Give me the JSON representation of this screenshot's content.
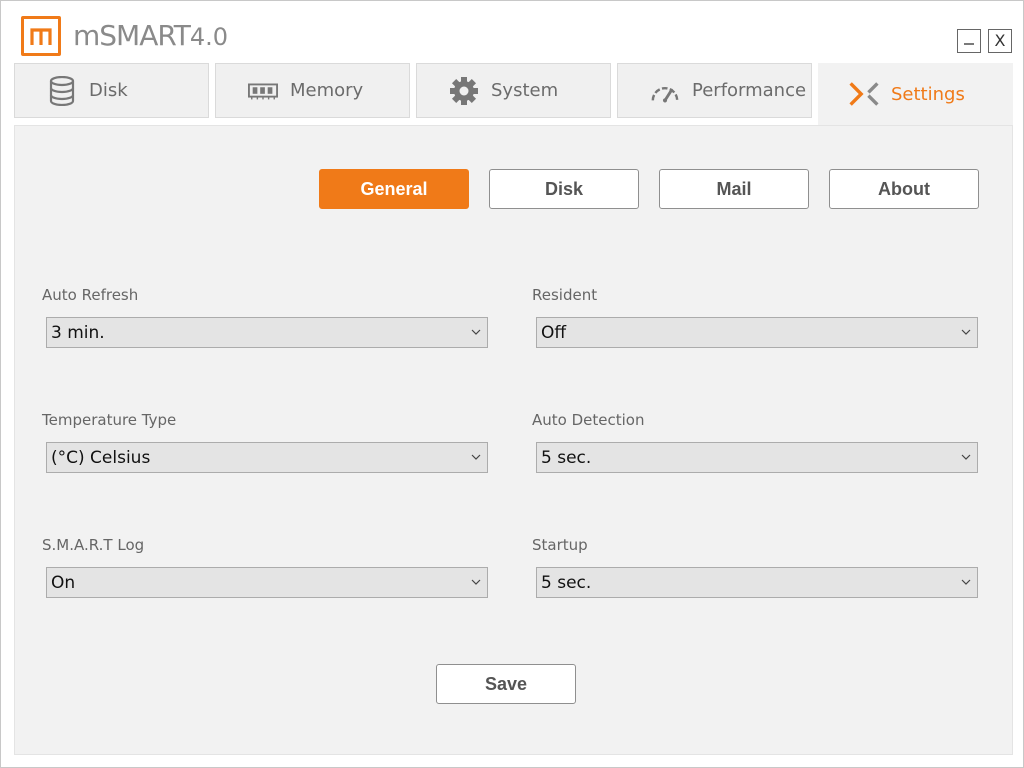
{
  "app": {
    "title_main": "mSMART",
    "title_version": "4.0",
    "logo_letter": "m",
    "minimize_symbol": "–",
    "close_symbol": "X"
  },
  "tabs": [
    {
      "label": "Disk",
      "icon": "database-icon",
      "active": false
    },
    {
      "label": "Memory",
      "icon": "memory-chip-icon",
      "active": false
    },
    {
      "label": "System",
      "icon": "gear-icon",
      "active": false
    },
    {
      "label": "Performance",
      "icon": "speedometer-icon",
      "active": false
    },
    {
      "label": "Settings",
      "icon": "settings-x-icon",
      "active": true
    }
  ],
  "subtabs": [
    {
      "label": "General",
      "active": true
    },
    {
      "label": "Disk",
      "active": false
    },
    {
      "label": "Mail",
      "active": false
    },
    {
      "label": "About",
      "active": false
    }
  ],
  "fields": {
    "auto_refresh": {
      "label": "Auto Refresh",
      "value": "3 min."
    },
    "resident": {
      "label": "Resident",
      "value": "Off"
    },
    "temperature_type": {
      "label": "Temperature Type",
      "value": "(°C) Celsius"
    },
    "auto_detection": {
      "label": "Auto Detection",
      "value": "5 sec."
    },
    "smart_log": {
      "label": "S.M.A.R.T Log",
      "value": "On"
    },
    "startup": {
      "label": "Startup",
      "value": "5 sec."
    }
  },
  "save_label": "Save",
  "colors": {
    "accent": "#f07a18",
    "panel_bg": "#f2f2f2",
    "select_bg": "#e4e4e4"
  }
}
